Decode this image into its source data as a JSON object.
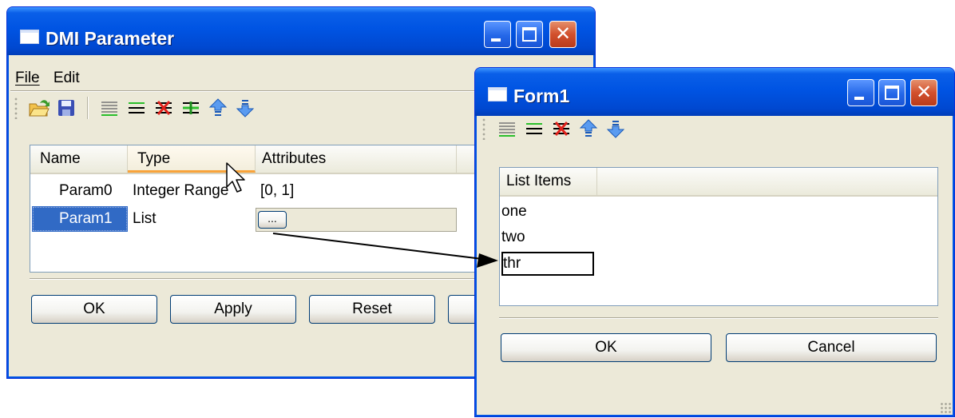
{
  "dmi_window": {
    "title": "DMI Parameter",
    "menu": [
      "File",
      "Edit"
    ],
    "columns": [
      "Name",
      "Type",
      "Attributes"
    ],
    "rows": [
      {
        "name": "Param0",
        "type": "Integer Range",
        "attributes": "[0, 1]"
      },
      {
        "name": "Param1",
        "type": "List",
        "attributes_button": "..."
      }
    ],
    "buttons": {
      "ok": "OK",
      "apply": "Apply",
      "reset": "Reset"
    }
  },
  "form_window": {
    "title": "Form1",
    "column": "List Items",
    "items": [
      "one",
      "two"
    ],
    "editing_value": "thr",
    "buttons": {
      "ok": "OK",
      "cancel": "Cancel"
    }
  },
  "icons": {
    "dmi_toolbar": [
      "open-folder-icon",
      "save-icon",
      "lines-icon",
      "add-line-icon",
      "delete-line-icon",
      "insert-line-icon",
      "move-up-icon",
      "move-down-icon"
    ],
    "form_toolbar": [
      "lines-icon",
      "add-line-icon",
      "delete-line-icon",
      "move-up-icon",
      "move-down-icon"
    ]
  },
  "colors": {
    "titlebar": "#0054e3",
    "close_button": "#d2502d",
    "selection": "#316ac5",
    "window_bg": "#ece9d8"
  }
}
